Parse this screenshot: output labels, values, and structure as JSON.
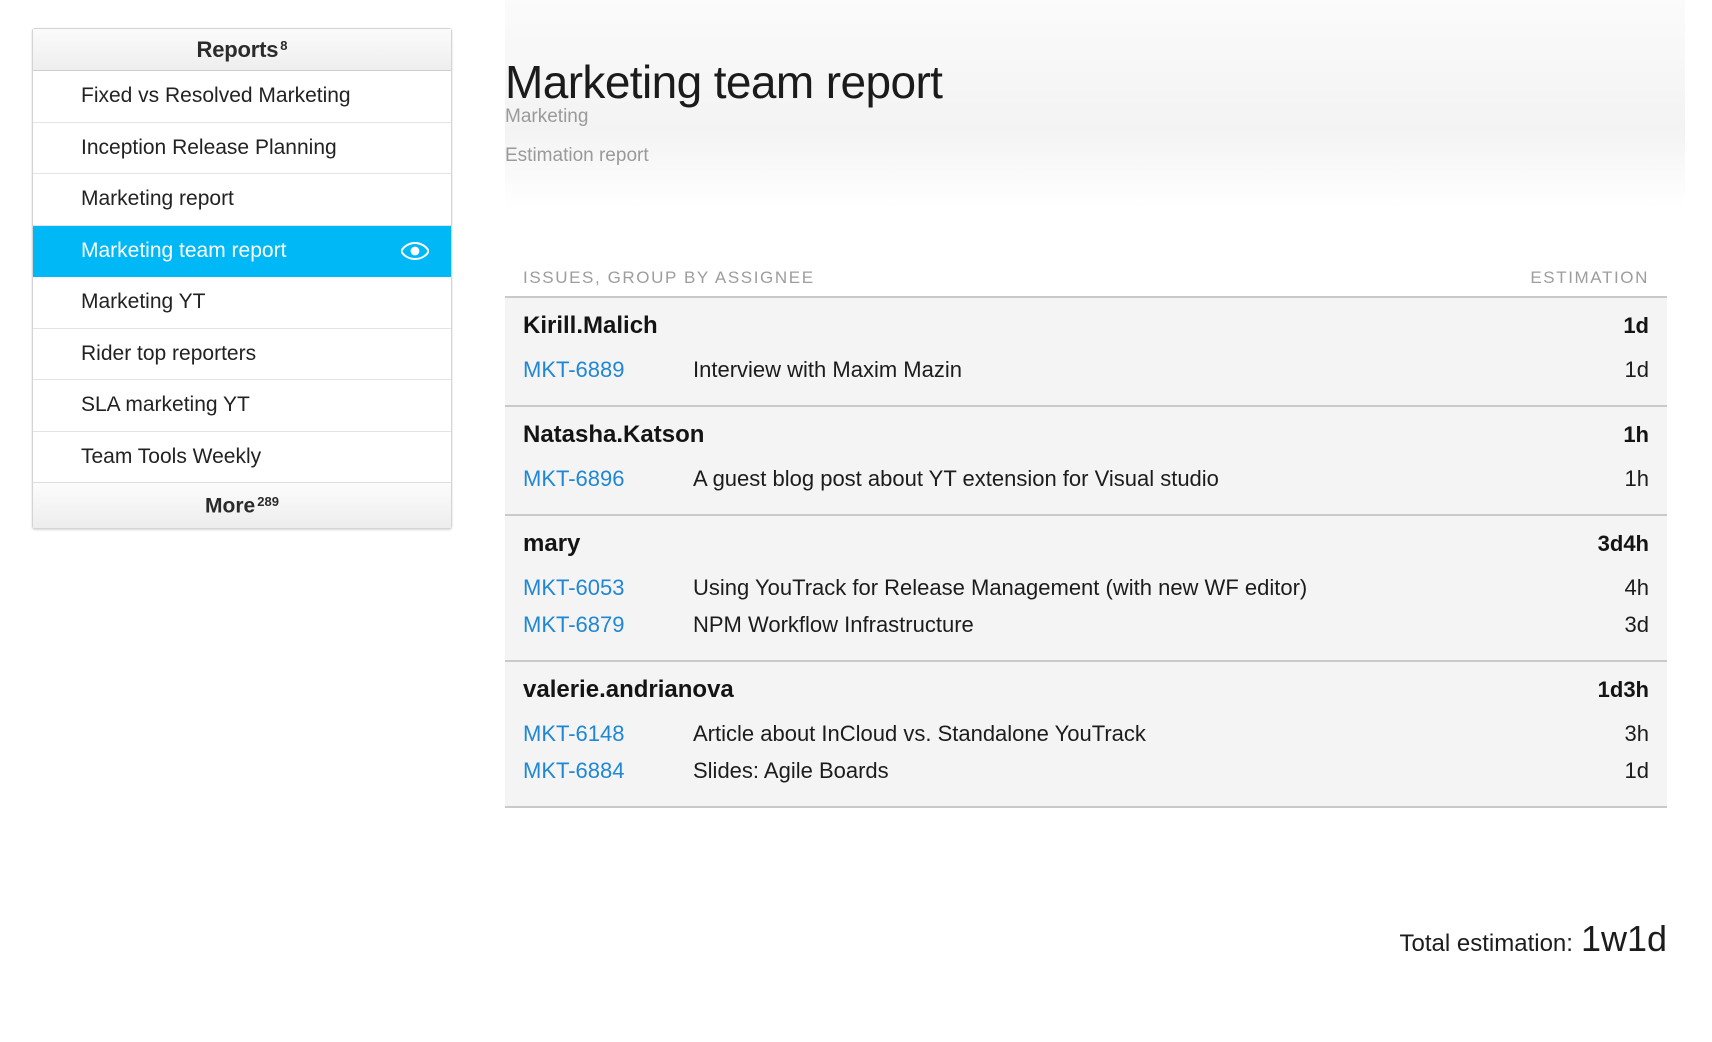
{
  "sidebar": {
    "header": {
      "title": "Reports",
      "count": "8"
    },
    "footer": {
      "label": "More",
      "count": "289"
    },
    "items": [
      {
        "label": "Fixed vs Resolved Marketing",
        "selected": false,
        "icon": ""
      },
      {
        "label": "Inception Release Planning",
        "selected": false,
        "icon": ""
      },
      {
        "label": "Marketing report",
        "selected": false,
        "icon": ""
      },
      {
        "label": "Marketing team report",
        "selected": true,
        "icon": "eye-icon"
      },
      {
        "label": "Marketing YT",
        "selected": false,
        "icon": ""
      },
      {
        "label": "Rider top reporters",
        "selected": false,
        "icon": ""
      },
      {
        "label": "SLA marketing YT",
        "selected": false,
        "icon": ""
      },
      {
        "label": "Team Tools Weekly",
        "selected": false,
        "icon": ""
      }
    ]
  },
  "header": {
    "title": "Marketing team report",
    "project": "Marketing",
    "report_type": "Estimation report"
  },
  "table": {
    "col_issues": "ISSUES, GROUP BY ASSIGNEE",
    "col_estimation": "ESTIMATION",
    "groups": [
      {
        "assignee": "Kirill.Malich",
        "total": "1d",
        "issues": [
          {
            "id": "MKT-6889",
            "summary": "Interview with Maxim Mazin",
            "estimation": "1d"
          }
        ]
      },
      {
        "assignee": "Natasha.Katson",
        "total": "1h",
        "issues": [
          {
            "id": "MKT-6896",
            "summary": "A guest blog post about YT extension for Visual studio",
            "estimation": "1h"
          }
        ]
      },
      {
        "assignee": "mary",
        "total": "3d4h",
        "issues": [
          {
            "id": "MKT-6053",
            "summary": "Using YouTrack for Release Management (with new WF editor)",
            "estimation": "4h"
          },
          {
            "id": "MKT-6879",
            "summary": "NPM Workflow Infrastructure",
            "estimation": "3d"
          }
        ]
      },
      {
        "assignee": "valerie.andrianova",
        "total": "1d3h",
        "issues": [
          {
            "id": "MKT-6148",
            "summary": "Article about InCloud vs. Standalone YouTrack",
            "estimation": "3h"
          },
          {
            "id": "MKT-6884",
            "summary": "Slides: Agile Boards",
            "estimation": "1d"
          }
        ]
      }
    ]
  },
  "footer": {
    "total_label": "Total estimation:",
    "total_value": "1w1d"
  },
  "colors": {
    "accent": "#00b8f5",
    "link": "#1f87d4",
    "muted": "#9a9a9a",
    "row_bg": "#f4f4f4"
  }
}
